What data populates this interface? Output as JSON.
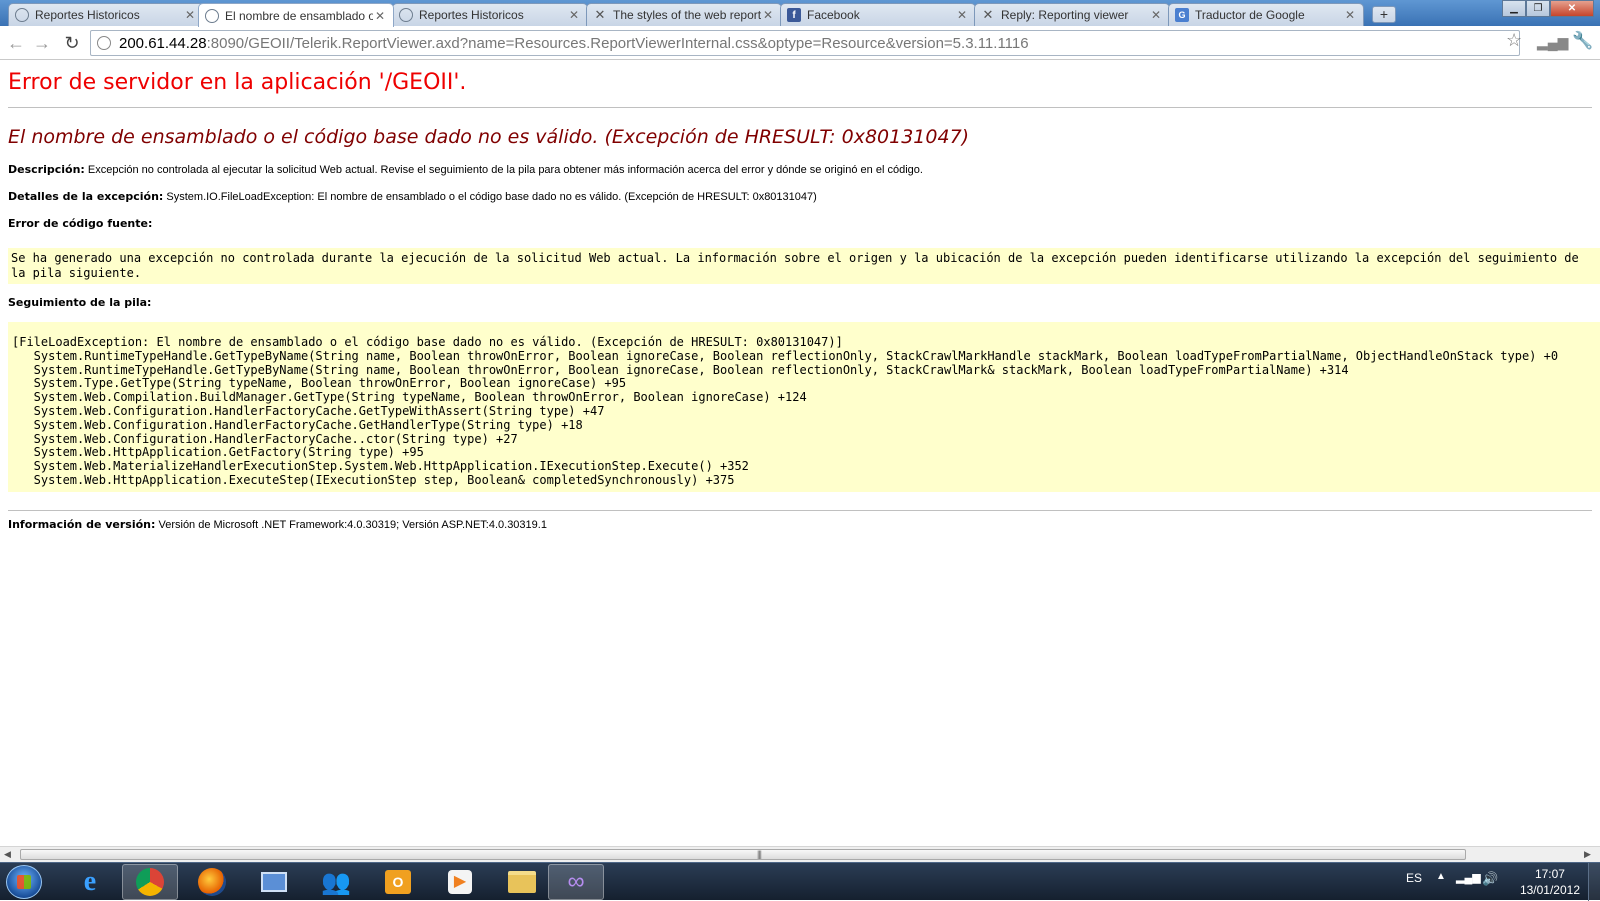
{
  "browser": {
    "tabs": [
      {
        "title": "Reportes Historicos",
        "icon": "globe-icon",
        "active": false
      },
      {
        "title": "El nombre de ensamblado o",
        "icon": "globe-icon",
        "active": true
      },
      {
        "title": "Reportes Historicos",
        "icon": "globe-icon",
        "active": false
      },
      {
        "title": "The styles of the web report",
        "icon": "telerik-icon",
        "active": false
      },
      {
        "title": "Facebook",
        "icon": "facebook-icon",
        "active": false
      },
      {
        "title": "Reply: Reporting viewer",
        "icon": "telerik-icon",
        "active": false
      },
      {
        "title": "Traductor de Google",
        "icon": "google-translate-icon",
        "active": false
      }
    ],
    "new_tab_label": "+",
    "url_host": "200.61.44.28",
    "url_rest": ":8090/GEOII/Telerik.ReportViewer.axd?name=Resources.ReportViewerInternal.css&optype=Resource&version=5.3.11.1116"
  },
  "page": {
    "title": "Error de servidor en la aplicación '/GEOII'.",
    "subtitle": "El nombre de ensamblado o el código base dado no es válido. (Excepción de HRESULT: 0x80131047)",
    "description_label": "Descripción:",
    "description_text": "Excepción no controlada al ejecutar la solicitud Web actual. Revise el seguimiento de la pila para obtener más información acerca del error y dónde se originó en el código.",
    "exception_label": "Detalles de la excepción:",
    "exception_text": "System.IO.FileLoadException: El nombre de ensamblado o el código base dado no es válido. (Excepción de HRESULT: 0x80131047)",
    "source_error_label": "Error de código fuente:",
    "source_error_text": "Se ha generado una excepción no controlada durante la ejecución de la solicitud Web actual. La información sobre el origen y la ubicación de la excepción pueden identificarse utilizando la excepción del seguimiento de la pila siguiente.",
    "stack_label": "Seguimiento de la pila:",
    "stack_lines": [
      "[FileLoadException: El nombre de ensamblado o el código base dado no es válido. (Excepción de HRESULT: 0x80131047)]",
      "   System.RuntimeTypeHandle.GetTypeByName(String name, Boolean throwOnError, Boolean ignoreCase, Boolean reflectionOnly, StackCrawlMarkHandle stackMark, Boolean loadTypeFromPartialName, ObjectHandleOnStack type) +0",
      "   System.RuntimeTypeHandle.GetTypeByName(String name, Boolean throwOnError, Boolean ignoreCase, Boolean reflectionOnly, StackCrawlMark& stackMark, Boolean loadTypeFromPartialName) +314",
      "   System.Type.GetType(String typeName, Boolean throwOnError, Boolean ignoreCase) +95",
      "   System.Web.Compilation.BuildManager.GetType(String typeName, Boolean throwOnError, Boolean ignoreCase) +124",
      "   System.Web.Configuration.HandlerFactoryCache.GetTypeWithAssert(String type) +47",
      "   System.Web.Configuration.HandlerFactoryCache.GetHandlerType(String type) +18",
      "   System.Web.Configuration.HandlerFactoryCache..ctor(String type) +27",
      "   System.Web.HttpApplication.GetFactory(String type) +95",
      "   System.Web.MaterializeHandlerExecutionStep.System.Web.HttpApplication.IExecutionStep.Execute() +352",
      "   System.Web.HttpApplication.ExecuteStep(IExecutionStep step, Boolean& completedSynchronously) +375"
    ],
    "version_label": "Información de versión:",
    "version_text": "Versión de Microsoft .NET Framework:4.0.30319; Versión ASP.NET:4.0.30319.1"
  },
  "taskbar": {
    "language": "ES",
    "time": "17:07",
    "date": "13/01/2012"
  },
  "colors": {
    "title_red": "#e00000",
    "subtitle_maroon": "#800000",
    "code_bg": "#ffffcc"
  }
}
